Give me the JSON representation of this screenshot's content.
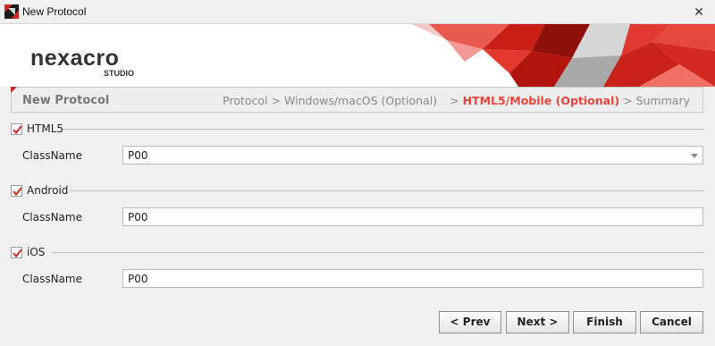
{
  "window": {
    "title": "New Protocol",
    "close_glyph": "✕"
  },
  "logo": {
    "brand": "nexacro",
    "sub": "STUDIO"
  },
  "wizard": {
    "title": "New Protocol",
    "steps": [
      {
        "label": "Protocol",
        "active": false
      },
      {
        "label": "Windows/macOS (Optional)",
        "active": false
      },
      {
        "label": "HTML5/Mobile (Optional)",
        "active": true
      },
      {
        "label": "Summary",
        "active": false
      }
    ],
    "separator": ">"
  },
  "sections": [
    {
      "label": "HTML5",
      "checked": true,
      "field_label": "ClassName",
      "value": "P00",
      "dropdown": true
    },
    {
      "label": "Android",
      "checked": true,
      "field_label": "ClassName",
      "value": "P00",
      "dropdown": false
    },
    {
      "label": "iOS",
      "checked": true,
      "field_label": "ClassName",
      "value": "P00",
      "dropdown": false
    }
  ],
  "buttons": {
    "prev": "< Prev",
    "next": "Next >",
    "finish": "Finish",
    "cancel": "Cancel"
  },
  "colors": {
    "accent": "#e8463a",
    "brand_red": "#cc2a1f"
  }
}
